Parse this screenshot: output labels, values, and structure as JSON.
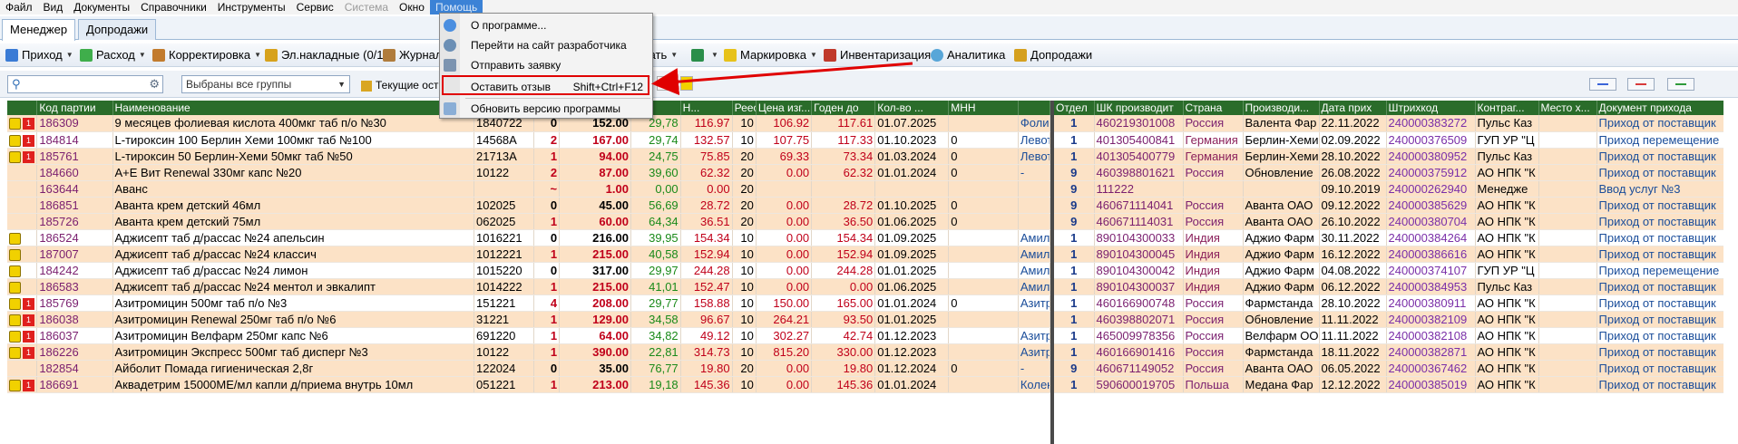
{
  "menubar": {
    "items": [
      {
        "label": "Файл"
      },
      {
        "label": "Вид"
      },
      {
        "label": "Документы"
      },
      {
        "label": "Справочники"
      },
      {
        "label": "Инструменты"
      },
      {
        "label": "Сервис"
      },
      {
        "label": "Система",
        "disabled": true
      },
      {
        "label": "Окно"
      },
      {
        "label": "Помощь",
        "active": true
      }
    ]
  },
  "tabs": [
    {
      "label": "Менеджер",
      "active": true
    },
    {
      "label": "Допродажи"
    }
  ],
  "toolbar": {
    "prihod": "Приход",
    "rashod": "Расход",
    "korrektirovka": "Корректировка",
    "el_nakladnye": "Эл.накладные (0/1)",
    "zhurnal": "Журнал",
    "pechat_partial": "ечать",
    "markirovka": "Маркировка",
    "inventarizaciya": "Инвентаризация",
    "analitika": "Аналитика",
    "doprodazhi": "Допродажи"
  },
  "toolbar2": {
    "search_placeholder": "",
    "group_select": "Выбраны все группы",
    "current_partial": "Текущие ост"
  },
  "help_menu": {
    "items": [
      {
        "label": "О программе...",
        "shortcut": ""
      },
      {
        "label": "Перейти на сайт разработчика",
        "shortcut": ""
      },
      {
        "label": "Отправить заявку",
        "shortcut": ""
      },
      {
        "label": "Оставить отзыв",
        "shortcut": "Shift+Ctrl+F12"
      },
      {
        "label": "Обновить версию программы",
        "shortcut": ""
      }
    ]
  },
  "colors": {
    "header_bg": "#2a6c2a",
    "row_peach": "#fce2c6",
    "highlight_red": "#e00000",
    "menu_active": "#3b82d6"
  },
  "left_grid": {
    "columns": [
      "",
      "Код партии",
      "Наименование",
      "",
      "",
      "",
      "",
      "Н...",
      "Реестр",
      "Цена изг...",
      "Годен до",
      "Кол-во ...",
      "МНН"
    ],
    "rows": [
      {
        "icons": [
          "y",
          "r"
        ],
        "code": "186309",
        "name": "9 месяцев фолиевая кислота 400мкг таб п/о №30",
        "c1": "1840722",
        "qty": "0",
        "price": "152.00",
        "pct": "29,78",
        "sum": "116.97",
        "n": "10",
        "reg": "106.92",
        "mfr": "117.61",
        "exp": "01.07.2025",
        "cnt": "",
        "mnn": "Фолиевая кис"
      },
      {
        "icons": [
          "y",
          "r"
        ],
        "code": "184814",
        "name": "L-тироксин 100 Берлин Хеми 100мкг таб №100",
        "c1": "14568А",
        "qty": "2",
        "price": "167.00",
        "pct": "29,74",
        "sum": "132.57",
        "n": "10",
        "reg": "107.75",
        "mfr": "117.33",
        "exp": "01.10.2023",
        "cnt": "0",
        "mnn": "Левотирокс"
      },
      {
        "icons": [
          "y",
          "r"
        ],
        "code": "185761",
        "name": "L-тироксин 50 Берлин-Хеми 50мкг таб №50",
        "c1": "21713А",
        "qty": "1",
        "price": "94.00",
        "pct": "24,75",
        "sum": "75.85",
        "n": "20",
        "reg": "69.33",
        "mfr": "73.34",
        "exp": "01.03.2024",
        "cnt": "0",
        "mnn": "Левотирокс"
      },
      {
        "icons": [],
        "code": "184660",
        "name": "А+Е Вит Renewal 330мг капс №20",
        "c1": "10122",
        "qty": "2",
        "price": "87.00",
        "pct": "39,60",
        "sum": "62.32",
        "n": "20",
        "reg": "0.00",
        "mfr": "62.32",
        "exp": "01.01.2024",
        "cnt": "0",
        "mnn": "-"
      },
      {
        "icons": [],
        "code": "163644",
        "name": "Аванс",
        "c1": "",
        "qty": "~",
        "price": "1.00",
        "pct": "0,00",
        "sum": "0.00",
        "n": "20",
        "reg": "",
        "mfr": "",
        "exp": "",
        "cnt": "",
        "mnn": ""
      },
      {
        "icons": [],
        "code": "186851",
        "name": "Аванта крем детский 46мл",
        "c1": "102025",
        "qty": "0",
        "price": "45.00",
        "pct": "56,69",
        "sum": "28.72",
        "n": "20",
        "reg": "0.00",
        "mfr": "28.72",
        "exp": "01.10.2025",
        "cnt": "0",
        "mnn": ""
      },
      {
        "icons": [],
        "code": "185726",
        "name": "Аванта крем детский 75мл",
        "c1": "062025",
        "qty": "1",
        "price": "60.00",
        "pct": "64,34",
        "sum": "36.51",
        "n": "20",
        "reg": "0.00",
        "mfr": "36.50",
        "exp": "01.06.2025",
        "cnt": "0",
        "mnn": ""
      },
      {
        "icons": [
          "y"
        ],
        "code": "186524",
        "name": "Аджисепт таб д/рассас №24 апельсин",
        "c1": "1016221",
        "qty": "0",
        "price": "216.00",
        "pct": "39,95",
        "sum": "154.34",
        "n": "10",
        "reg": "0.00",
        "mfr": "154.34",
        "exp": "01.09.2025",
        "cnt": "",
        "mnn": "Амилметакре"
      },
      {
        "icons": [
          "y"
        ],
        "code": "187007",
        "name": "Аджисепт таб д/рассас №24 классич",
        "c1": "1012221",
        "qty": "1",
        "price": "215.00",
        "pct": "40,58",
        "sum": "152.94",
        "n": "10",
        "reg": "0.00",
        "mfr": "152.94",
        "exp": "01.09.2025",
        "cnt": "",
        "mnn": "Амилметакре"
      },
      {
        "icons": [
          "y"
        ],
        "code": "184242",
        "name": "Аджисепт таб д/рассас №24 лимон",
        "c1": "1015220",
        "qty": "0",
        "price": "317.00",
        "pct": "29,97",
        "sum": "244.28",
        "n": "10",
        "reg": "0.00",
        "mfr": "244.28",
        "exp": "01.01.2025",
        "cnt": "",
        "mnn": "Амилметакре"
      },
      {
        "icons": [
          "y"
        ],
        "code": "186583",
        "name": "Аджисепт таб д/рассас №24 ментол и эвкалипт",
        "c1": "1014222",
        "qty": "1",
        "price": "215.00",
        "pct": "41,01",
        "sum": "152.47",
        "n": "10",
        "reg": "0.00",
        "mfr": "0.00",
        "exp": "01.06.2025",
        "cnt": "",
        "mnn": "Амилметакре"
      },
      {
        "icons": [
          "y",
          "r"
        ],
        "code": "185769",
        "name": "Азитромицин 500мг таб п/о №3",
        "c1": "151221",
        "qty": "4",
        "price": "208.00",
        "pct": "29,77",
        "sum": "158.88",
        "n": "10",
        "reg": "150.00",
        "mfr": "165.00",
        "exp": "01.01.2024",
        "cnt": "0",
        "mnn": "Азитромицин"
      },
      {
        "icons": [
          "y",
          "r"
        ],
        "code": "186038",
        "name": "Азитромицин Renewal 250мг таб п/о №6",
        "c1": "31221",
        "qty": "1",
        "price": "129.00",
        "pct": "34,58",
        "sum": "96.67",
        "n": "10",
        "reg": "264.21",
        "mfr": "93.50",
        "exp": "01.01.2025",
        "cnt": "",
        "mnn": ""
      },
      {
        "icons": [
          "y",
          "r"
        ],
        "code": "186037",
        "name": "Азитромицин Велфарм 250мг капс №6",
        "c1": "691220",
        "qty": "1",
        "price": "64.00",
        "pct": "34,82",
        "sum": "49.12",
        "n": "10",
        "reg": "302.27",
        "mfr": "42.74",
        "exp": "01.12.2023",
        "cnt": "",
        "mnn": "Азитромицин"
      },
      {
        "icons": [
          "y",
          "r"
        ],
        "code": "186226",
        "name": "Азитромицин Экспресс 500мг таб дисперг №3",
        "c1": "10122",
        "qty": "1",
        "price": "390.00",
        "pct": "22,81",
        "sum": "314.73",
        "n": "10",
        "reg": "815.20",
        "mfr": "330.00",
        "exp": "01.12.2023",
        "cnt": "",
        "mnn": "Азитромицин"
      },
      {
        "icons": [],
        "code": "182854",
        "name": "Айболит Помада гигиеническая 2,8г",
        "c1": "122024",
        "qty": "0",
        "price": "35.00",
        "pct": "76,77",
        "sum": "19.80",
        "n": "20",
        "reg": "0.00",
        "mfr": "19.80",
        "exp": "01.12.2024",
        "cnt": "0",
        "mnn": "-"
      },
      {
        "icons": [
          "y",
          "r"
        ],
        "code": "186691",
        "name": "Аквадетрим 15000МЕ/мл капли д/приема внутрь 10мл",
        "c1": "051221",
        "qty": "1",
        "price": "213.00",
        "pct": "19,18",
        "sum": "145.36",
        "n": "10",
        "reg": "0.00",
        "mfr": "145.36",
        "exp": "01.01.2024",
        "cnt": "",
        "mnn": "Колекальци"
      }
    ]
  },
  "right_grid": {
    "columns": [
      "Отдел",
      "ШК производит",
      "Страна",
      "Производи...",
      "Дата прих",
      "Штрихкод",
      "Контраг...",
      "Место х...",
      "Документ прихода"
    ],
    "rows": [
      {
        "dept": "1",
        "shk": "460219301008",
        "country": "Россия",
        "maker": "Валента Фар",
        "date": "22.11.2022",
        "bar": "240000383272",
        "ctr": "Пульс Каз",
        "place": "",
        "doc": "Приход от поставщик"
      },
      {
        "dept": "1",
        "shk": "401305400841",
        "country": "Германия",
        "maker": "Берлин-Хеми",
        "date": "02.09.2022",
        "bar": "240000376509",
        "ctr": "ГУП УР \"Ц",
        "place": "",
        "doc": "Приход перемещение"
      },
      {
        "dept": "1",
        "shk": "401305400779",
        "country": "Германия",
        "maker": "Берлин-Хеми",
        "date": "28.10.2022",
        "bar": "240000380952",
        "ctr": "Пульс Каз",
        "place": "",
        "doc": "Приход от поставщик"
      },
      {
        "dept": "9",
        "shk": "460398801621",
        "country": "Россия",
        "maker": "Обновление",
        "date": "26.08.2022",
        "bar": "240000375912",
        "ctr": "АО НПК \"К",
        "place": "",
        "doc": "Приход от поставщик"
      },
      {
        "dept": "9",
        "shk": "111222",
        "country": "",
        "maker": "",
        "date": "09.10.2019",
        "bar": "240000262940",
        "ctr": "Менедже",
        "place": "",
        "doc": "Ввод услуг №3"
      },
      {
        "dept": "9",
        "shk": "460671114041",
        "country": "Россия",
        "maker": "Аванта ОАО",
        "date": "09.12.2022",
        "bar": "240000385629",
        "ctr": "АО НПК \"К",
        "place": "",
        "doc": "Приход от поставщик"
      },
      {
        "dept": "9",
        "shk": "460671114031",
        "country": "Россия",
        "maker": "Аванта ОАО",
        "date": "26.10.2022",
        "bar": "240000380704",
        "ctr": "АО НПК \"К",
        "place": "",
        "doc": "Приход от поставщик"
      },
      {
        "dept": "1",
        "shk": "890104300033",
        "country": "Индия",
        "maker": "Аджио Фарм",
        "date": "30.11.2022",
        "bar": "240000384264",
        "ctr": "АО НПК \"К",
        "place": "",
        "doc": "Приход от поставщик"
      },
      {
        "dept": "1",
        "shk": "890104300045",
        "country": "Индия",
        "maker": "Аджио Фарм",
        "date": "16.12.2022",
        "bar": "240000386616",
        "ctr": "АО НПК \"К",
        "place": "",
        "doc": "Приход от поставщик"
      },
      {
        "dept": "1",
        "shk": "890104300042",
        "country": "Индия",
        "maker": "Аджио Фарм",
        "date": "04.08.2022",
        "bar": "240000374107",
        "ctr": "ГУП УР \"Ц",
        "place": "",
        "doc": "Приход перемещение"
      },
      {
        "dept": "1",
        "shk": "890104300037",
        "country": "Индия",
        "maker": "Аджио Фарм",
        "date": "06.12.2022",
        "bar": "240000384953",
        "ctr": "Пульс Каз",
        "place": "",
        "doc": "Приход от поставщик"
      },
      {
        "dept": "1",
        "shk": "460166900748",
        "country": "Россия",
        "maker": "Фармстанда",
        "date": "28.10.2022",
        "bar": "240000380911",
        "ctr": "АО НПК \"К",
        "place": "",
        "doc": "Приход от поставщик"
      },
      {
        "dept": "1",
        "shk": "460398802071",
        "country": "Россия",
        "maker": "Обновление",
        "date": "11.11.2022",
        "bar": "240000382109",
        "ctr": "АО НПК \"К",
        "place": "",
        "doc": "Приход от поставщик"
      },
      {
        "dept": "1",
        "shk": "465009978356",
        "country": "Россия",
        "maker": "Велфарм ОО",
        "date": "11.11.2022",
        "bar": "240000382108",
        "ctr": "АО НПК \"К",
        "place": "",
        "doc": "Приход от поставщик"
      },
      {
        "dept": "1",
        "shk": "460166901416",
        "country": "Россия",
        "maker": "Фармстанда",
        "date": "18.11.2022",
        "bar": "240000382871",
        "ctr": "АО НПК \"К",
        "place": "",
        "doc": "Приход от поставщик"
      },
      {
        "dept": "9",
        "shk": "460671149052",
        "country": "Россия",
        "maker": "Аванта ОАО",
        "date": "06.05.2022",
        "bar": "240000367462",
        "ctr": "АО НПК \"К",
        "place": "",
        "doc": "Приход от поставщик"
      },
      {
        "dept": "1",
        "shk": "590600019705",
        "country": "Польша",
        "maker": "Медана Фар",
        "date": "12.12.2022",
        "bar": "240000385019",
        "ctr": "АО НПК \"К",
        "place": "",
        "doc": "Приход от поставщик"
      }
    ]
  }
}
